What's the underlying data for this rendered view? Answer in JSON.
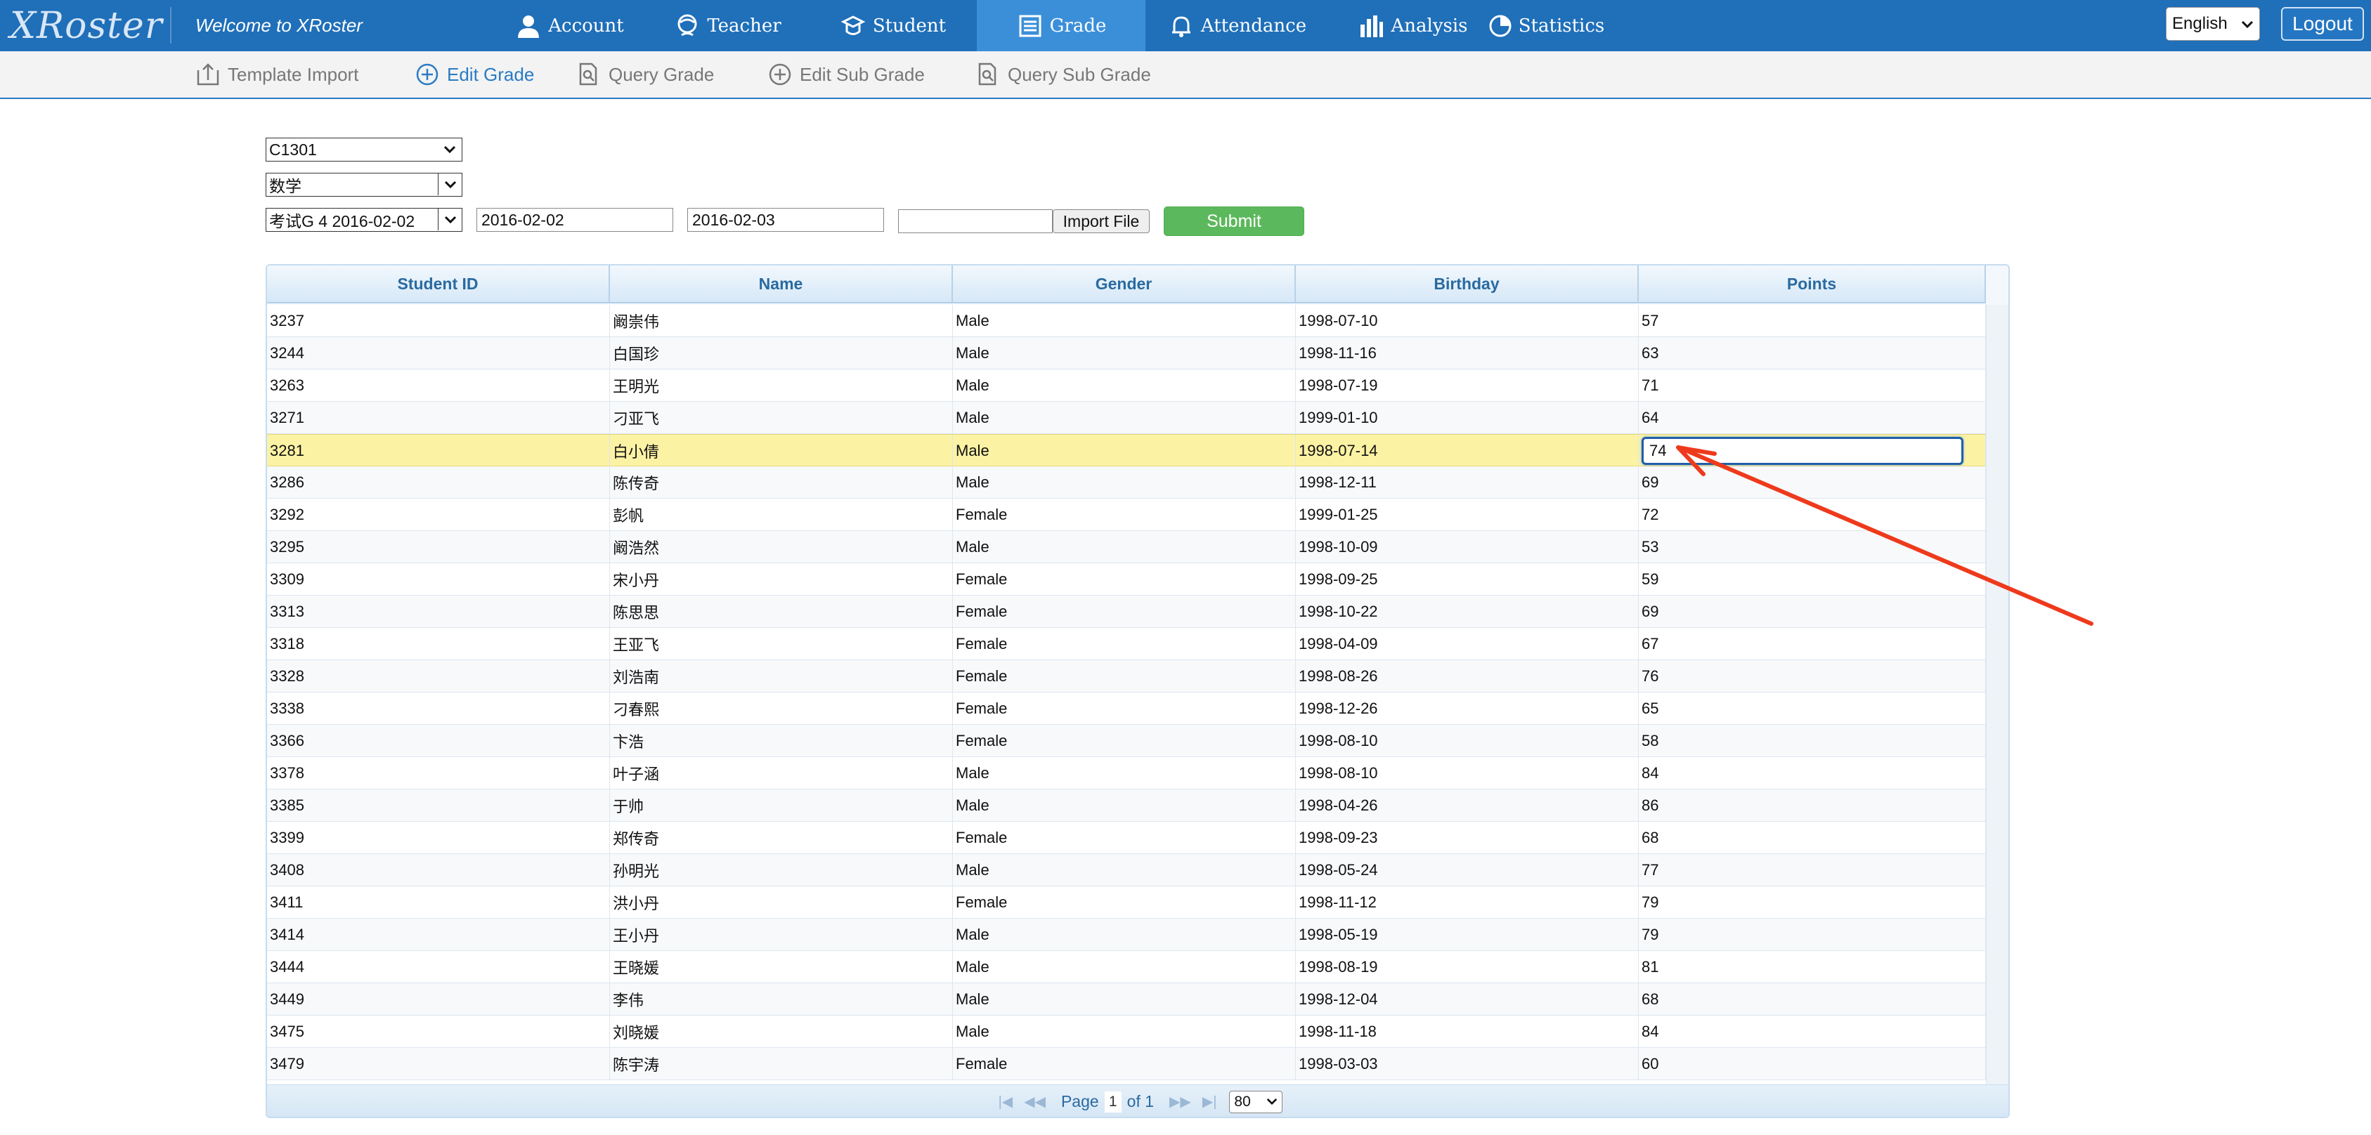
{
  "app": {
    "logo_text": "XRoster",
    "welcome": "Welcome to XRoster"
  },
  "nav": [
    {
      "label": "Account",
      "icon": "user-icon",
      "active": false
    },
    {
      "label": "Teacher",
      "icon": "teacher-icon",
      "active": false
    },
    {
      "label": "Student",
      "icon": "student-icon",
      "active": false
    },
    {
      "label": "Grade",
      "icon": "grade-icon",
      "active": true
    },
    {
      "label": "Attendance",
      "icon": "bell-icon",
      "active": false
    },
    {
      "label": "Analysis",
      "icon": "bar-chart-icon",
      "active": false
    },
    {
      "label": "Statistics",
      "icon": "pie-chart-icon",
      "active": false
    }
  ],
  "header_right": {
    "language": "English",
    "logout": "Logout"
  },
  "subnav": [
    {
      "label": "Template Import",
      "icon": "upload-icon",
      "active": false
    },
    {
      "label": "Edit Grade",
      "icon": "plus-circle-icon",
      "active": true
    },
    {
      "label": "Query Grade",
      "icon": "search-doc-icon",
      "active": false
    },
    {
      "label": "Edit Sub Grade",
      "icon": "plus-circle-icon",
      "active": false
    },
    {
      "label": "Query Sub Grade",
      "icon": "search-doc-icon",
      "active": false
    }
  ],
  "filters": {
    "class": "C1301",
    "subject": "数学",
    "exam": "考试G 4 2016-02-02",
    "start_date": "2016-02-02",
    "end_date": "2016-02-03",
    "file_value": "",
    "import_label": "Import File",
    "submit_label": "Submit"
  },
  "table": {
    "columns": [
      "Student ID",
      "Name",
      "Gender",
      "Birthday",
      "Points"
    ],
    "selected_row": 4,
    "rows": [
      [
        "3237",
        "阚崇伟",
        "Male",
        "1998-07-10",
        "57"
      ],
      [
        "3244",
        "白国珍",
        "Male",
        "1998-11-16",
        "63"
      ],
      [
        "3263",
        "王明光",
        "Male",
        "1998-07-19",
        "71"
      ],
      [
        "3271",
        "刁亚飞",
        "Male",
        "1999-01-10",
        "64"
      ],
      [
        "3281",
        "白小倩",
        "Male",
        "1998-07-14",
        "74"
      ],
      [
        "3286",
        "陈传奇",
        "Male",
        "1998-12-11",
        "69"
      ],
      [
        "3292",
        "彭帆",
        "Female",
        "1999-01-25",
        "72"
      ],
      [
        "3295",
        "阚浩然",
        "Male",
        "1998-10-09",
        "53"
      ],
      [
        "3309",
        "宋小丹",
        "Female",
        "1998-09-25",
        "59"
      ],
      [
        "3313",
        "陈思思",
        "Female",
        "1998-10-22",
        "69"
      ],
      [
        "3318",
        "王亚飞",
        "Female",
        "1998-04-09",
        "67"
      ],
      [
        "3328",
        "刘浩南",
        "Female",
        "1998-08-26",
        "76"
      ],
      [
        "3338",
        "刁春熙",
        "Female",
        "1998-12-26",
        "65"
      ],
      [
        "3366",
        "卞浩",
        "Female",
        "1998-08-10",
        "58"
      ],
      [
        "3378",
        "叶子涵",
        "Male",
        "1998-08-10",
        "84"
      ],
      [
        "3385",
        "于帅",
        "Male",
        "1998-04-26",
        "86"
      ],
      [
        "3399",
        "郑传奇",
        "Female",
        "1998-09-23",
        "68"
      ],
      [
        "3408",
        "孙明光",
        "Male",
        "1998-05-24",
        "77"
      ],
      [
        "3411",
        "洪小丹",
        "Female",
        "1998-11-12",
        "79"
      ],
      [
        "3414",
        "王小丹",
        "Male",
        "1998-05-19",
        "79"
      ],
      [
        "3444",
        "王晓媛",
        "Male",
        "1998-08-19",
        "81"
      ],
      [
        "3449",
        "李伟",
        "Male",
        "1998-12-04",
        "68"
      ],
      [
        "3475",
        "刘晓媛",
        "Male",
        "1998-11-18",
        "84"
      ],
      [
        "3479",
        "陈宇涛",
        "Female",
        "1998-03-03",
        "60"
      ]
    ]
  },
  "pager": {
    "page_label": "Page",
    "page": "1",
    "of_label": "of 1",
    "page_size": "80"
  },
  "annotation": {
    "arrow_color": "#ee3a1c"
  }
}
